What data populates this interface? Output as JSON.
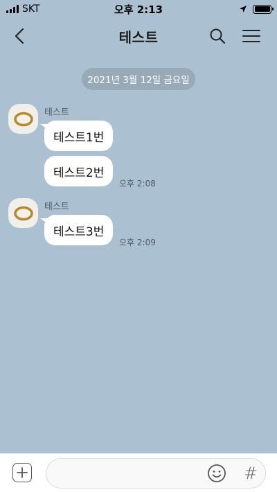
{
  "status_bar": {
    "carrier": "SKT",
    "time": "오후 2:13",
    "battery_level": 1.0
  },
  "header": {
    "title": "테스트",
    "icons": [
      "back-icon",
      "search-icon",
      "menu-icon"
    ]
  },
  "chat": {
    "date_divider": "2021년 3월 12일 금요일",
    "groups": [
      {
        "sender": "테스트",
        "messages": [
          {
            "text": "테스트1번",
            "time": ""
          },
          {
            "text": "테스트2번",
            "time": "오후 2:08"
          }
        ]
      },
      {
        "sender": "테스트",
        "messages": [
          {
            "text": "테스트3번",
            "time": "오후 2:09"
          }
        ]
      }
    ]
  },
  "input_bar": {
    "value": "",
    "placeholder": "",
    "icons": [
      "plus-icon",
      "emoji-icon",
      "hashtag-icon"
    ],
    "hash_symbol": "#"
  },
  "colors": {
    "chat_background": "#abc1d1",
    "bubble": "#ffffff",
    "date_pill": "#98aab8"
  }
}
